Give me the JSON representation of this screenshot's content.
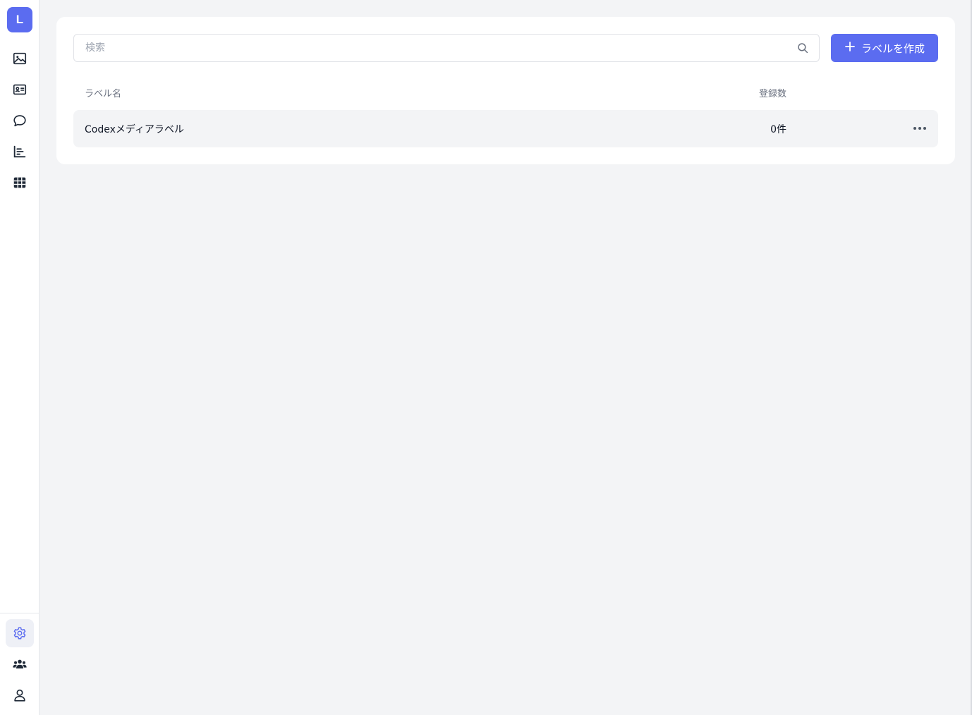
{
  "sidebar": {
    "logo_letter": "L",
    "nav_icons": [
      "image-icon",
      "id-card-icon",
      "chat-bubble-icon",
      "bar-chart-icon",
      "table-grid-icon"
    ],
    "bottom_icons": [
      "settings-gear-icon",
      "team-users-icon",
      "user-profile-icon"
    ],
    "active_item": "settings-gear-icon",
    "active_color": "#5b6cf0"
  },
  "search": {
    "placeholder": "検索",
    "value": ""
  },
  "toolbar": {
    "create_label": "ラベルを作成",
    "accent_color": "#5b6cf0"
  },
  "table": {
    "headers": {
      "name": "ラベル名",
      "count": "登録数"
    },
    "rows": [
      {
        "name": "Codexメディアラベル",
        "count": "0件"
      }
    ]
  }
}
